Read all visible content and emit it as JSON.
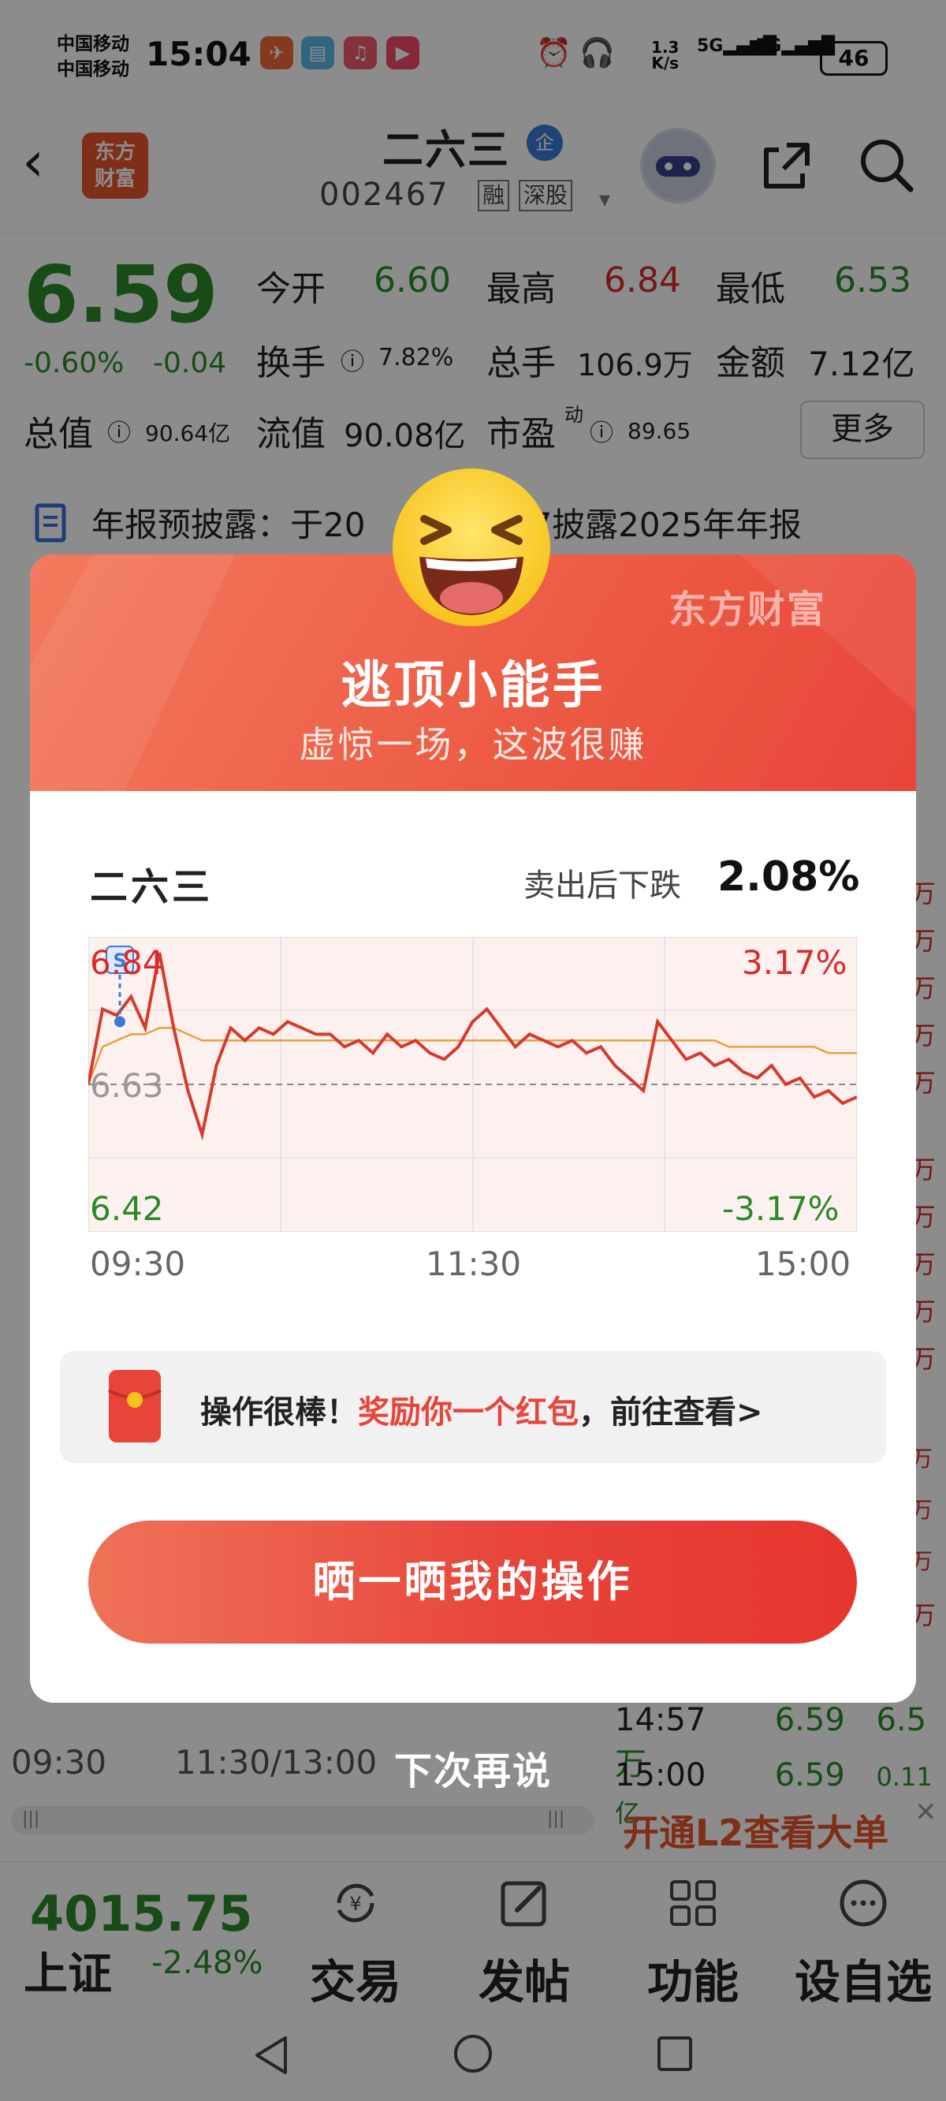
{
  "status_bar": {
    "carrier1": "中国移动",
    "carrier2": "中国移动",
    "time": "15:04",
    "net_speed_top": "1.3",
    "net_speed_bottom": "K/s",
    "signal1": "5G",
    "signal2": "5G",
    "battery": "46"
  },
  "header": {
    "logo_line1": "东方",
    "logo_line2": "财富",
    "stock_name": "二六三",
    "badge": "企",
    "stock_code": "002467",
    "tag_margin": "融",
    "tag_market": "深股"
  },
  "quote": {
    "price": "6.59",
    "change_pct": "-0.60%",
    "change_amt": "-0.04",
    "open_label": "今开",
    "open": "6.60",
    "high_label": "最高",
    "high": "6.84",
    "low_label": "最低",
    "low": "6.53",
    "turnover_label": "换手",
    "turnover": "7.82%",
    "volume_label": "总手",
    "volume": "106.9万",
    "amount_label": "金额",
    "amount": "7.12亿",
    "total_value_label": "总值",
    "total_value": "90.64亿",
    "float_value_label": "流值",
    "float_value": "90.08亿",
    "pe_label": "市盈",
    "pe_sup": "动",
    "pe": "89.65",
    "more": "更多"
  },
  "notice": {
    "text": "年报预披露：于20",
    "text_tail": "7披露2025年年报"
  },
  "background": {
    "ticks": [
      {
        "time": "14:57",
        "price": "6.59",
        "vol": "6.5万"
      },
      {
        "time": "15:00",
        "price": "6.59",
        "vol": "0.11亿"
      }
    ],
    "axis_start": "09:30",
    "axis_mid": "11:30/13:00",
    "l2_link": "开通L2查看大单",
    "wan": "万"
  },
  "bottom_nav": {
    "index_value": "4015.75",
    "index_name": "上证",
    "index_pct": "-2.48%",
    "items": [
      {
        "label": "交易",
        "icon": "yuan-exchange-icon"
      },
      {
        "label": "发帖",
        "icon": "edit-post-icon"
      },
      {
        "label": "功能",
        "icon": "grid-apps-icon"
      },
      {
        "label": "设自选",
        "icon": "add-watchlist-icon"
      }
    ]
  },
  "modal": {
    "brand": "东方财富",
    "title": "逃顶小能手",
    "subtitle": "虚惊一场，这波很赚",
    "stock_name": "二六三",
    "drop_label": "卖出后下跌",
    "drop_value": "2.08%",
    "promo_prefix": "操作很棒！",
    "promo_highlight": "奖励你一个红包",
    "promo_suffix": "，前往查看>",
    "share_button": "晒一晒我的操作",
    "later": "下次再说",
    "sell_marker": "S"
  },
  "chart_data": {
    "type": "line",
    "title": "",
    "x_ticks": [
      "09:30",
      "11:30",
      "15:00"
    ],
    "y_left_ticks": [
      "6.84",
      "6.63",
      "6.42"
    ],
    "y_right_ticks": [
      "3.17%",
      "-3.17%"
    ],
    "ylim": [
      6.42,
      6.84
    ],
    "prev_close": 6.63,
    "sell_price": 6.73,
    "series": [
      {
        "color": "#d63a2f",
        "values": [
          6.63,
          6.75,
          6.74,
          6.77,
          6.72,
          6.84,
          6.72,
          6.62,
          6.55,
          6.66,
          6.72,
          6.7,
          6.72,
          6.71,
          6.73,
          6.72,
          6.71,
          6.71,
          6.69,
          6.7,
          6.68,
          6.71,
          6.69,
          6.7,
          6.68,
          6.67,
          6.69,
          6.73,
          6.75,
          6.72,
          6.69,
          6.71,
          6.7,
          6.69,
          6.7,
          6.68,
          6.69,
          6.66,
          6.64,
          6.62,
          6.73,
          6.7,
          6.67,
          6.68,
          6.66,
          6.67,
          6.65,
          6.64,
          6.66,
          6.63,
          6.64,
          6.61,
          6.62,
          6.6,
          6.61
        ]
      },
      {
        "color": "#e6a23c",
        "values": [
          6.63,
          6.69,
          6.7,
          6.71,
          6.71,
          6.72,
          6.72,
          6.71,
          6.7,
          6.7,
          6.7,
          6.7,
          6.7,
          6.7,
          6.7,
          6.7,
          6.7,
          6.7,
          6.7,
          6.7,
          6.7,
          6.7,
          6.7,
          6.7,
          6.7,
          6.7,
          6.7,
          6.7,
          6.7,
          6.7,
          6.7,
          6.7,
          6.7,
          6.7,
          6.7,
          6.7,
          6.7,
          6.7,
          6.7,
          6.7,
          6.7,
          6.7,
          6.7,
          6.7,
          6.7,
          6.69,
          6.69,
          6.69,
          6.69,
          6.69,
          6.69,
          6.69,
          6.68,
          6.68,
          6.68
        ]
      }
    ]
  }
}
